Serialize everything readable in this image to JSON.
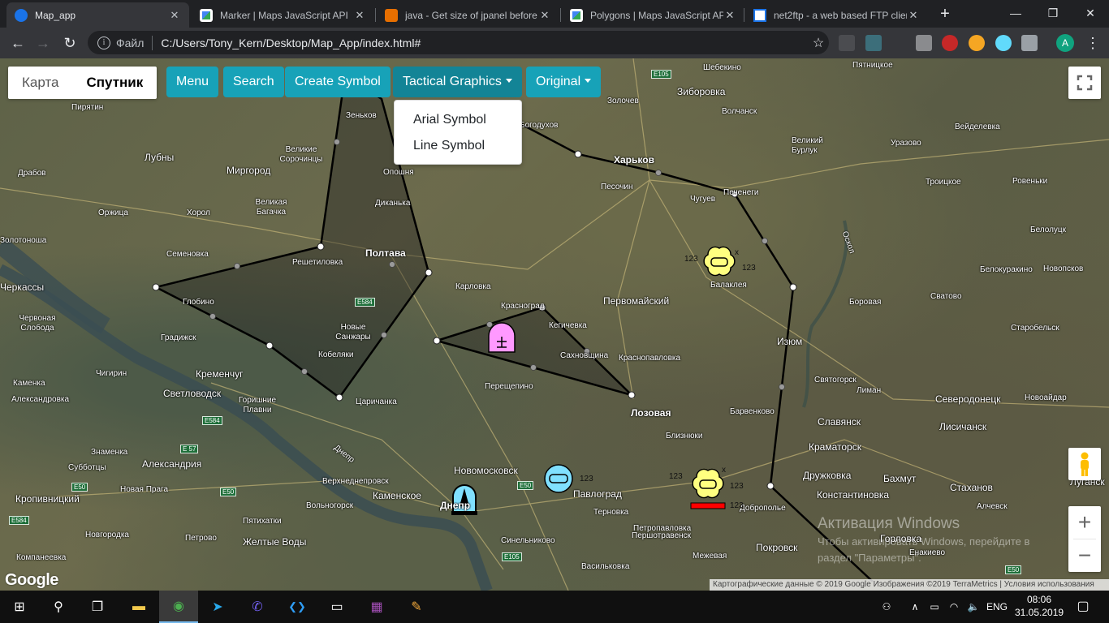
{
  "browser": {
    "tabs": [
      {
        "title": "Map_app",
        "active": true,
        "icon": "globe-icon"
      },
      {
        "title": "Marker | Maps JavaScript API",
        "icon": "google-maps-icon"
      },
      {
        "title": "java - Get size of jpanel before",
        "icon": "java-icon"
      },
      {
        "title": "Polygons | Maps JavaScript API",
        "icon": "google-maps-icon"
      },
      {
        "title": "net2ftp - a web based FTP client",
        "icon": "net2ftp-icon"
      }
    ],
    "tab_close_glyph": "✕",
    "new_tab_glyph": "+",
    "window_controls": {
      "minimize": "—",
      "restore": "❐",
      "close": "✕"
    },
    "nav": {
      "back": "←",
      "forward": "→",
      "reload": "↻"
    },
    "omnibox": {
      "info_glyph": "i",
      "scheme_label": "Файл",
      "url": "C:/Users/Tony_Kern/Desktop/Map_App/index.html#",
      "star_glyph": "☆"
    },
    "profile_initial": "A",
    "menu_glyph": "⋮"
  },
  "map": {
    "map_type": {
      "map_label": "Карта",
      "satellite_label": "Спутник"
    },
    "toolbar": {
      "menu_label": "Menu",
      "search_label": "Search",
      "create_symbol_label": "Create Symbol",
      "tactical_graphics_label": "Tactical Graphics",
      "original_label": "Original"
    },
    "tactical_dropdown": [
      "Arial Symbol",
      "Line Symbol"
    ],
    "fullscreen_glyph": "⛶",
    "zoom_in_glyph": "+",
    "zoom_out_glyph": "−",
    "google_logo": "Google",
    "attribution": "Картографические данные © 2019 Google Изображения ©2019 TerraMetrics  |  Условия использования",
    "activation": {
      "title": "Активация Windows",
      "subtitle": "Чтобы активировать Windows, перейдите в раздел \"Параметры\"."
    },
    "symbol_labels": {
      "number": "123",
      "x": "x"
    },
    "places": [
      {
        "name": "Шебекино",
        "cls": ""
      },
      {
        "name": "Пятницкое",
        "cls": ""
      },
      {
        "name": "Зиборовка",
        "cls": "med"
      },
      {
        "name": "Волчанск",
        "cls": ""
      },
      {
        "name": "Золочев",
        "cls": ""
      },
      {
        "name": "Пирятин",
        "cls": ""
      },
      {
        "name": "Зеньков",
        "cls": ""
      },
      {
        "name": "Богодухов",
        "cls": ""
      },
      {
        "name": "Вейделевка",
        "cls": ""
      },
      {
        "name": "Великие Сорочинцы",
        "cls": ""
      },
      {
        "name": "Лубны",
        "cls": "med"
      },
      {
        "name": "Миргород",
        "cls": "med"
      },
      {
        "name": "Харьков",
        "cls": "big"
      },
      {
        "name": "Великий Бурлук",
        "cls": ""
      },
      {
        "name": "Уразово",
        "cls": ""
      },
      {
        "name": "Драбов",
        "cls": ""
      },
      {
        "name": "Опошня",
        "cls": ""
      },
      {
        "name": "Песочин",
        "cls": ""
      },
      {
        "name": "Чугуев",
        "cls": ""
      },
      {
        "name": "Печенеги",
        "cls": ""
      },
      {
        "name": "Троицкое",
        "cls": ""
      },
      {
        "name": "Ровеньки",
        "cls": ""
      },
      {
        "name": "Великая Багачка",
        "cls": ""
      },
      {
        "name": "Диканька",
        "cls": ""
      },
      {
        "name": "Оржица",
        "cls": ""
      },
      {
        "name": "Хорол",
        "cls": ""
      },
      {
        "name": "Белолуцк",
        "cls": ""
      },
      {
        "name": "Золотоноша",
        "cls": ""
      },
      {
        "name": "Семеновка",
        "cls": ""
      },
      {
        "name": "Полтава",
        "cls": "big"
      },
      {
        "name": "Решетиловка",
        "cls": ""
      },
      {
        "name": "Карловка",
        "cls": ""
      },
      {
        "name": "Балаклея",
        "cls": ""
      },
      {
        "name": "Белокуракино",
        "cls": ""
      },
      {
        "name": "Новопсков",
        "cls": ""
      },
      {
        "name": "Черкассы",
        "cls": "med"
      },
      {
        "name": "Глобино",
        "cls": ""
      },
      {
        "name": "Первомайский",
        "cls": "med"
      },
      {
        "name": "Боровая",
        "cls": ""
      },
      {
        "name": "Сватово",
        "cls": ""
      },
      {
        "name": "Червоная Слобода",
        "cls": ""
      },
      {
        "name": "Красноград",
        "cls": ""
      },
      {
        "name": "Кегичевка",
        "cls": ""
      },
      {
        "name": "Градижск",
        "cls": ""
      },
      {
        "name": "Новые Санжары",
        "cls": ""
      },
      {
        "name": "Изюм",
        "cls": "med"
      },
      {
        "name": "Старобельск",
        "cls": ""
      },
      {
        "name": "Кобеляки",
        "cls": ""
      },
      {
        "name": "Сахновщина",
        "cls": ""
      },
      {
        "name": "Краснопавловка",
        "cls": ""
      },
      {
        "name": "Чигирин",
        "cls": ""
      },
      {
        "name": "Кременчуг",
        "cls": "med"
      },
      {
        "name": "Святогорск",
        "cls": ""
      },
      {
        "name": "Каменка",
        "cls": ""
      },
      {
        "name": "Перещепино",
        "cls": ""
      },
      {
        "name": "Лиман",
        "cls": ""
      },
      {
        "name": "Александровка",
        "cls": ""
      },
      {
        "name": "Светловодск",
        "cls": "med"
      },
      {
        "name": "Царичанка",
        "cls": ""
      },
      {
        "name": "Лозовая",
        "cls": "big"
      },
      {
        "name": "Северодонецк",
        "cls": "med"
      },
      {
        "name": "Новоайдар",
        "cls": ""
      },
      {
        "name": "Горишние Плавни",
        "cls": ""
      },
      {
        "name": "Барвенково",
        "cls": ""
      },
      {
        "name": "Славянск",
        "cls": "med"
      },
      {
        "name": "Лисичанск",
        "cls": "med"
      },
      {
        "name": "Близнюки",
        "cls": ""
      },
      {
        "name": "Знаменка",
        "cls": ""
      },
      {
        "name": "Александрия",
        "cls": "med"
      },
      {
        "name": "Краматорск",
        "cls": "med"
      },
      {
        "name": "Днепр",
        "cls": ""
      },
      {
        "name": "Субботцы",
        "cls": ""
      },
      {
        "name": "Новомосковск",
        "cls": "med"
      },
      {
        "name": "Дружковка",
        "cls": "med"
      },
      {
        "name": "Бахмут",
        "cls": "med"
      },
      {
        "name": "Верхнеднепровск",
        "cls": ""
      },
      {
        "name": "Павлоград",
        "cls": "med"
      },
      {
        "name": "Луганск",
        "cls": "med"
      },
      {
        "name": "Кропивницкий",
        "cls": "med"
      },
      {
        "name": "Новая Прага",
        "cls": ""
      },
      {
        "name": "Каменское",
        "cls": "med"
      },
      {
        "name": "Константиновка",
        "cls": "med"
      },
      {
        "name": "Стаханов",
        "cls": "med"
      },
      {
        "name": "Днепр",
        "cls": "big"
      },
      {
        "name": "Вольногорск",
        "cls": ""
      },
      {
        "name": "Терновка",
        "cls": ""
      },
      {
        "name": "Доброполье",
        "cls": ""
      },
      {
        "name": "Алчевск",
        "cls": ""
      },
      {
        "name": "Пятихатки",
        "cls": ""
      },
      {
        "name": "Синельниково",
        "cls": ""
      },
      {
        "name": "Новгородка",
        "cls": ""
      },
      {
        "name": "Петропавловка",
        "cls": ""
      },
      {
        "name": "Горловка",
        "cls": "med"
      },
      {
        "name": "Петрово",
        "cls": ""
      },
      {
        "name": "Желтые Воды",
        "cls": "med"
      },
      {
        "name": "Першотравенск",
        "cls": ""
      },
      {
        "name": "Компанеевка",
        "cls": ""
      },
      {
        "name": "Межевая",
        "cls": ""
      },
      {
        "name": "Покровск",
        "cls": "med"
      },
      {
        "name": "Енакиево",
        "cls": ""
      },
      {
        "name": "Васильковка",
        "cls": ""
      },
      {
        "name": "Оскол",
        "cls": ""
      }
    ],
    "road_shields": [
      "E105",
      "E584",
      "E584",
      "E 57",
      "E50",
      "E50",
      "E50",
      "E584",
      "E105",
      "E50"
    ]
  },
  "taskbar": {
    "apps": [
      {
        "name": "start-icon",
        "glyph": "⊞"
      },
      {
        "name": "search-icon",
        "glyph": "⚲"
      },
      {
        "name": "task-view-icon",
        "glyph": "❐"
      },
      {
        "name": "file-explorer-icon",
        "glyph": "▬"
      },
      {
        "name": "chrome-icon",
        "glyph": "◉"
      },
      {
        "name": "telegram-icon",
        "glyph": "➤"
      },
      {
        "name": "viber-icon",
        "glyph": "✆"
      },
      {
        "name": "vscode-icon",
        "glyph": "❮❯"
      },
      {
        "name": "terminal-icon",
        "glyph": "▭"
      },
      {
        "name": "winrar-icon",
        "glyph": "▦"
      },
      {
        "name": "paint-icon",
        "glyph": "✎"
      }
    ],
    "tray": {
      "people": "⚇",
      "chevron": "∧",
      "battery": "▭",
      "wifi": "◠",
      "volume": "🔈",
      "lang": "ENG",
      "notifications": "▢"
    },
    "time": "08:06",
    "date": "31.05.2019"
  }
}
